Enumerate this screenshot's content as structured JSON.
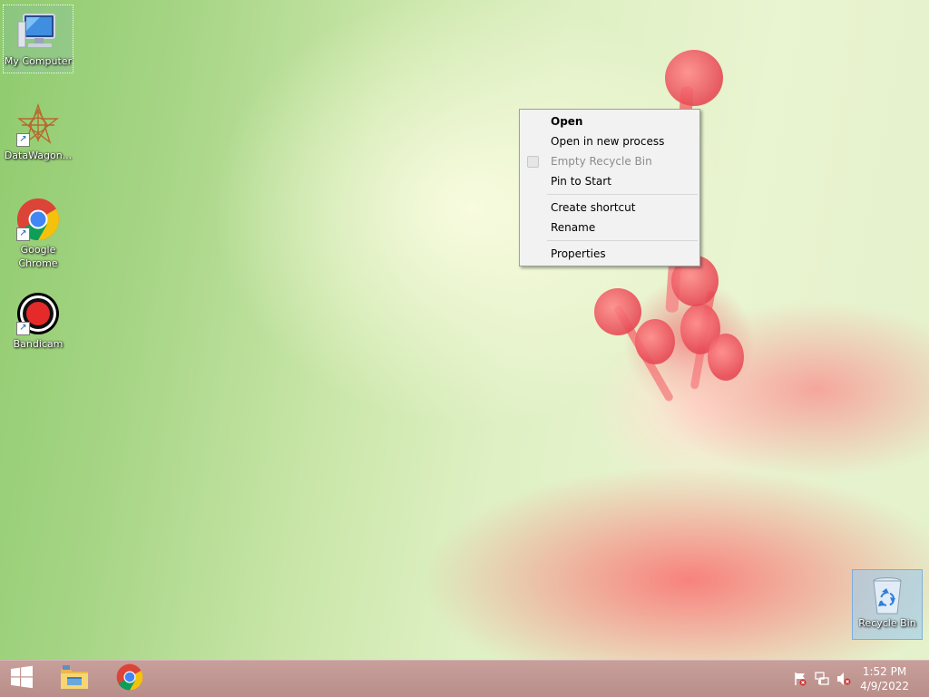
{
  "desktop": {
    "icons": [
      {
        "label": "My Computer",
        "icon": "computer-icon"
      },
      {
        "label": "DataWagon...",
        "icon": "datawagon-icon"
      },
      {
        "label": "Google Chrome",
        "icon": "chrome-icon"
      },
      {
        "label": "Bandicam",
        "icon": "bandicam-icon"
      }
    ],
    "recycle_bin": {
      "label": "Recycle Bin",
      "icon": "recycle-bin-icon"
    }
  },
  "context_menu": {
    "items": [
      {
        "label": "Open"
      },
      {
        "label": "Open in new process"
      },
      {
        "label": "Empty Recycle Bin"
      },
      {
        "label": "Pin to Start"
      },
      {
        "label": "Create shortcut"
      },
      {
        "label": "Rename"
      },
      {
        "label": "Properties"
      }
    ]
  },
  "taskbar": {
    "start": {
      "icon": "windows-logo-icon"
    },
    "pinned": [
      {
        "icon": "file-explorer-icon"
      },
      {
        "icon": "chrome-icon"
      }
    ],
    "tray": [
      {
        "icon": "action-center-flag-icon"
      },
      {
        "icon": "network-icon"
      },
      {
        "icon": "volume-muted-icon"
      }
    ],
    "clock": {
      "time": "1:52 PM",
      "date": "4/9/2022"
    }
  },
  "colors": {
    "taskbar": "#c09591",
    "menu_bg": "#f2f2f2",
    "chrome_red": "#db4437",
    "chrome_yellow": "#f4c20d",
    "chrome_green": "#0f9d58",
    "chrome_blue": "#4285f4"
  }
}
